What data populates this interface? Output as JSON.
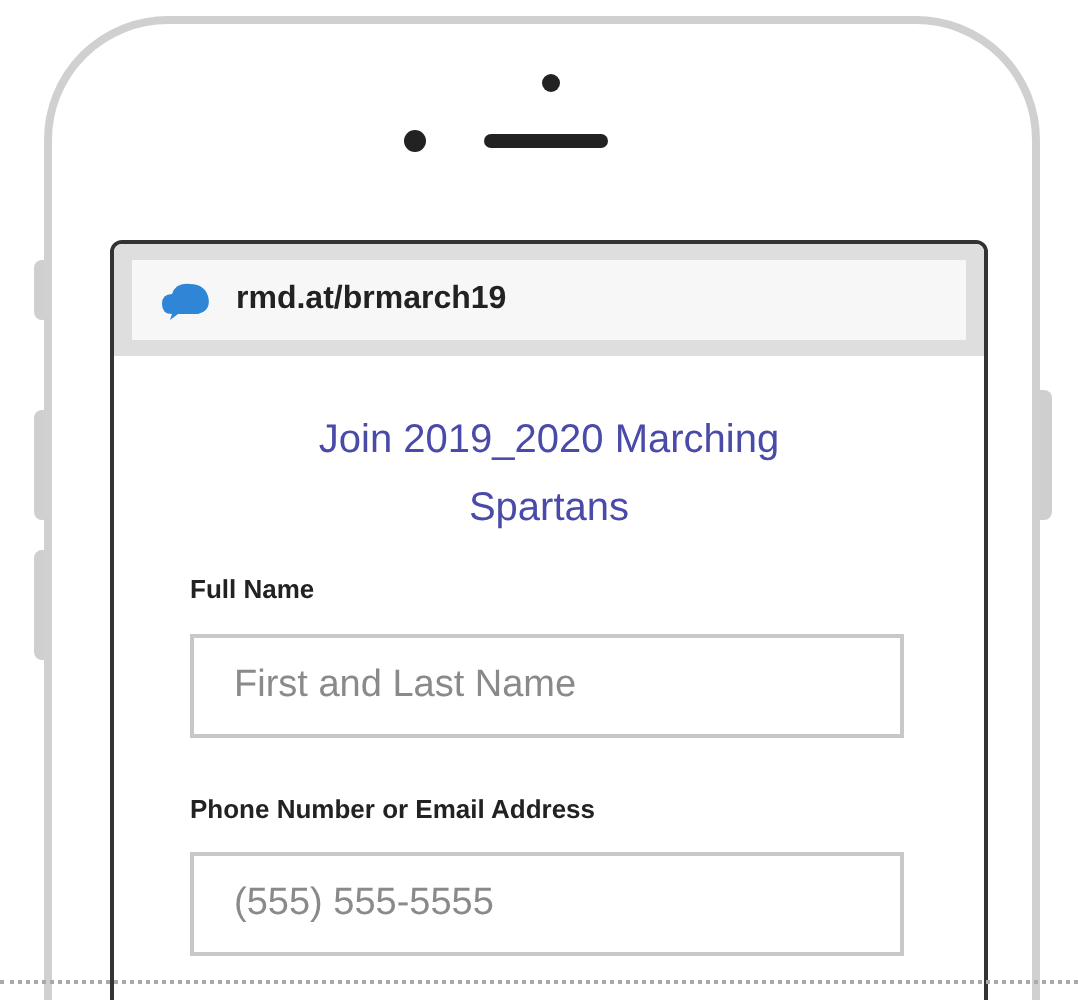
{
  "browser": {
    "url": "rmd.at/brmarch19"
  },
  "form": {
    "title": "Join 2019_2020 Marching Spartans",
    "fields": [
      {
        "label": "Full Name",
        "placeholder": "First and Last Name"
      },
      {
        "label": "Phone Number or Email Address",
        "placeholder": "(555) 555-5555"
      }
    ]
  }
}
